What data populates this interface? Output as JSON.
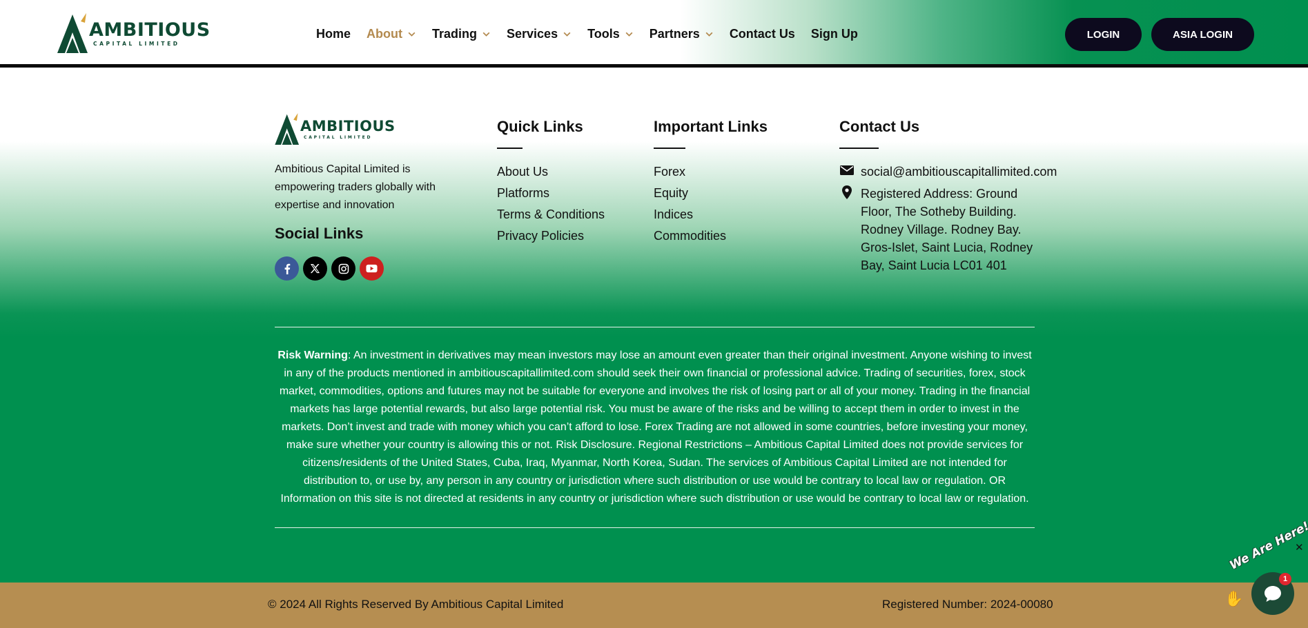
{
  "header": {
    "logo": {
      "brand": "AMBITIOUS",
      "sub": "CAPITAL LIMITED"
    },
    "nav": [
      {
        "label": "Home",
        "dropdown": false,
        "active": false
      },
      {
        "label": "About",
        "dropdown": true,
        "active": true
      },
      {
        "label": "Trading",
        "dropdown": true,
        "active": false
      },
      {
        "label": "Services",
        "dropdown": true,
        "active": false
      },
      {
        "label": "Tools",
        "dropdown": true,
        "active": false
      },
      {
        "label": "Partners",
        "dropdown": true,
        "active": false
      },
      {
        "label": "Contact Us",
        "dropdown": false,
        "active": false
      },
      {
        "label": "Sign Up",
        "dropdown": false,
        "active": false
      }
    ],
    "login_label": "LOGIN",
    "asia_login_label": "ASIA LOGIN"
  },
  "footer": {
    "logo": {
      "brand": "AMBITIOUS",
      "sub": "CAPITAL LIMITED"
    },
    "about_text": "Ambitious Capital Limited is empowering traders globally with expertise and innovation",
    "social_title": "Social Links",
    "socials": [
      "facebook-icon",
      "x-icon",
      "instagram-icon",
      "youtube-icon"
    ],
    "quick_links": {
      "title": "Quick Links",
      "items": [
        "About Us",
        "Platforms",
        "Terms & Conditions",
        "Privacy Policies"
      ]
    },
    "important_links": {
      "title": "Important Links",
      "items": [
        "Forex",
        "Equity",
        "Indices",
        "Commodities"
      ]
    },
    "contact": {
      "title": "Contact Us",
      "email": "social@ambitiouscapitallimited.com",
      "address": "Registered Address: Ground Floor, The Sotheby Building. Rodney Village. Rodney Bay. Gros-Islet, Saint Lucia, Rodney Bay, Saint Lucia LC01 401"
    },
    "risk_label": "Risk Warning",
    "risk_text": ": An investment in derivatives may mean investors may lose an amount even greater than their original investment. Anyone wishing to invest in any of the products mentioned in ambitiouscapitallimited.com should seek their own financial or professional advice. Trading of securities, forex, stock market, commodities, options and futures may not be suitable for everyone and involves the risk of losing part or all of your money. Trading in the financial markets has large potential rewards, but also large potential risk. You must be aware of the risks and be willing to accept them in order to invest in the markets. Don’t invest and trade with money which you can’t afford to lose. Forex Trading are not allowed in some countries, before investing your money, make sure whether your country is allowing this or not. Risk Disclosure. Regional Restrictions – Ambitious Capital Limited does not provide services for citizens/residents of the United States, Cuba, Iraq, Myanmar, North Korea, Sudan. The services of Ambitious Capital Limited are not intended for distribution to, or use by, any person in any country or jurisdiction where such distribution or use would be contrary to local law or regulation. OR Information on this site is not directed at residents in any country or jurisdiction where such distribution or use would be contrary to local law or regulation.",
    "copyright": "© 2024 All Rights Reserved By Ambitious Capital Limited",
    "registered_number": "Registered Number: 2024-00080"
  },
  "chat": {
    "label": "We Are Here!",
    "badge": "1",
    "close": "✕"
  },
  "colors": {
    "brand_green": "#00904f",
    "logo_green": "#0f4a33",
    "accent_gold": "#b38a4f",
    "bottom_bar": "#b68e51",
    "button_dark": "#0d0a1e"
  }
}
